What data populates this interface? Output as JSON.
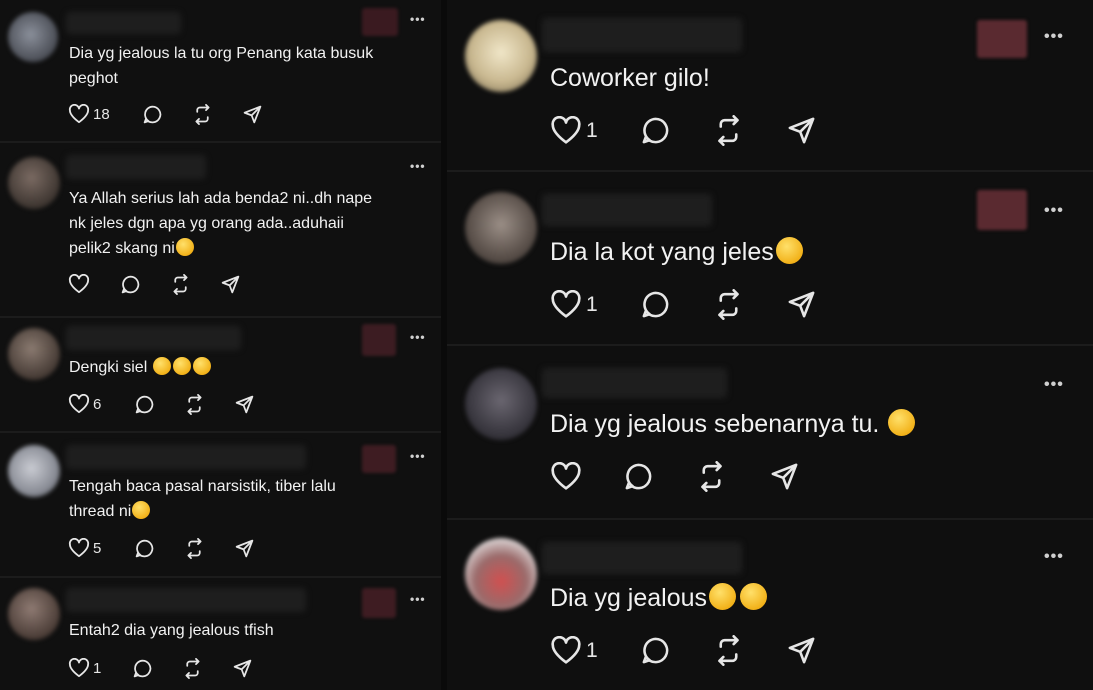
{
  "left_column": {
    "posts": [
      {
        "text": "Dia yg jealous la tu org Penang kata busuk\npeghot",
        "emojis": [],
        "likes": "18",
        "more": "•••"
      },
      {
        "text": "Ya Allah serius lah ada benda2 ni..dh nape\nnk jeles dgn apa yg orang ada..aduhaii\npelik2 skang ni",
        "emojis": [
          "laughing-tears"
        ],
        "likes": "",
        "more": "•••"
      },
      {
        "text": "Dengki siel",
        "emojis": [
          "flushed",
          "flushed",
          "flushed"
        ],
        "likes": "6",
        "more": "•••"
      },
      {
        "text": "Tengah baca pasal narsistik, tiber lalu\nthread ni",
        "emojis": [
          "rofl"
        ],
        "likes": "5",
        "more": "•••"
      },
      {
        "text": "Entah2 dia yang jealous tfish",
        "emojis": [],
        "likes": "1",
        "more": "•••"
      }
    ]
  },
  "right_column": {
    "posts": [
      {
        "text": "Coworker gilo!",
        "emojis": [],
        "likes": "1",
        "more": "•••"
      },
      {
        "text": "Dia la kot yang jeles",
        "emojis": [
          "laughing-tears"
        ],
        "likes": "1",
        "more": "•••"
      },
      {
        "text": "Dia yg jealous sebenarnya tu.",
        "emojis": [
          "hand-over-mouth"
        ],
        "likes": "",
        "more": "•••"
      },
      {
        "text": "Dia yg jealous",
        "emojis": [
          "melting-face",
          "melting-face"
        ],
        "likes": "1",
        "more": "•••"
      }
    ]
  },
  "colors": {
    "background": "#101010",
    "text": "#f2f2f2",
    "icon": "#e6e6e6",
    "divider": "#1c1c1c"
  }
}
